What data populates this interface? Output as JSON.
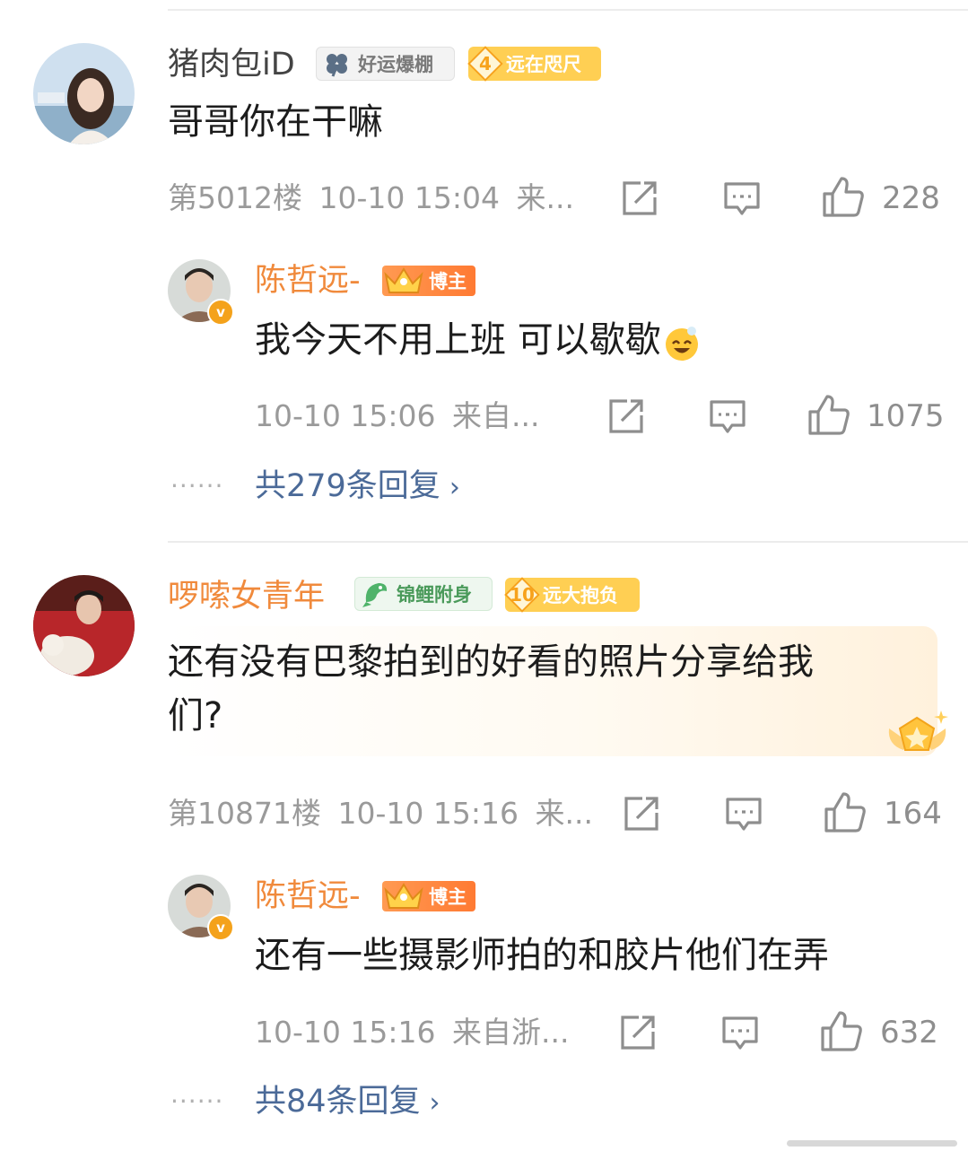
{
  "comments": [
    {
      "user": "猪肉包iD",
      "fan_badge": "好运爆棚",
      "level": "4",
      "level_title": "远在咫尺",
      "text": "哥哥你在干嘛",
      "floor": "第5012楼",
      "time": "10-10 15:04",
      "source": "来...",
      "likes": "228",
      "reply": {
        "user": "陈哲远-",
        "role": "博主",
        "text": "我今天不用上班 可以歇歇",
        "time": "10-10 15:06",
        "source": "来自...",
        "likes": "1075"
      },
      "more_replies": "共279条回复"
    },
    {
      "user": "啰嗦女青年",
      "fan_badge": "锦鲤附身",
      "level": "10",
      "level_title": "远大抱负",
      "text_line1": "还有没有巴黎拍到的好看的照片分享给我",
      "text_line2": "们?",
      "floor": "第10871楼",
      "time": "10-10 15:16",
      "source": "来...",
      "likes": "164",
      "reply": {
        "user": "陈哲远-",
        "role": "博主",
        "text": "还有一些摄影师拍的和胶片他们在弄",
        "time": "10-10 15:16",
        "source": "来自浙...",
        "likes": "632"
      },
      "more_replies": "共84条回复"
    }
  ],
  "icons": {
    "verified": "v",
    "chevron": "›",
    "dots": "······"
  },
  "colors": {
    "host_name": "#f08a3c",
    "link": "#4b6a98",
    "meta": "#9a9a9a"
  }
}
